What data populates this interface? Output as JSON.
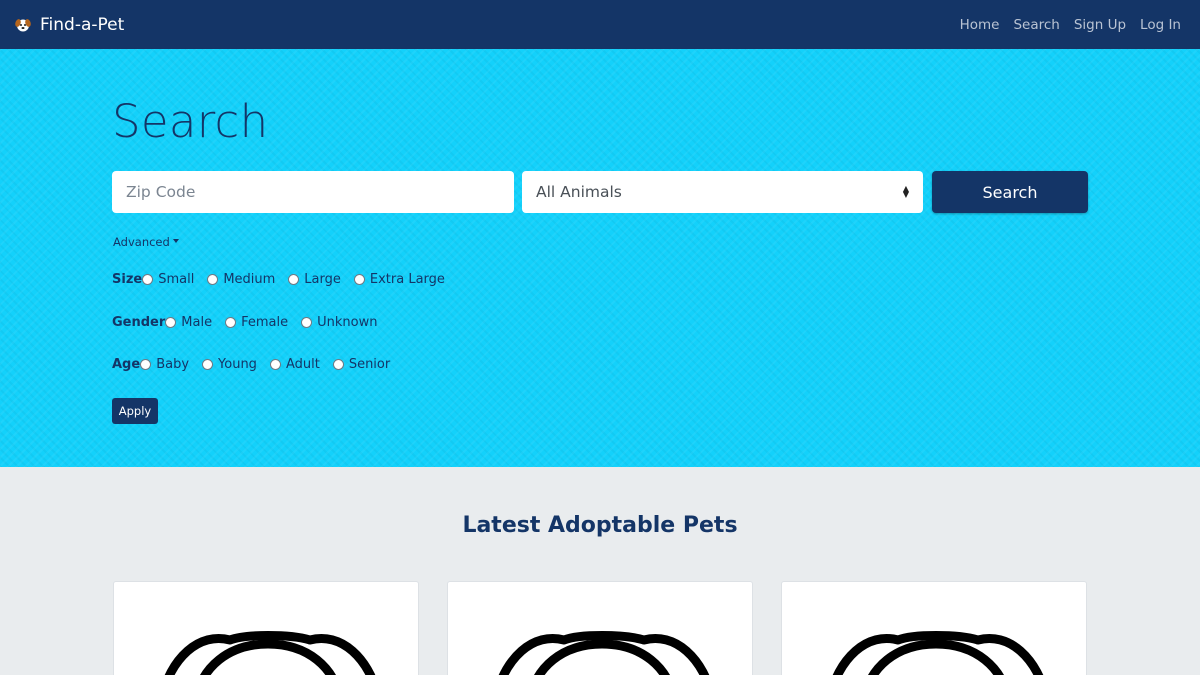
{
  "navbar": {
    "brand": "Find-a-Pet",
    "brand_icon": "dog-face-icon",
    "links": [
      "Home",
      "Search",
      "Sign Up",
      "Log In"
    ]
  },
  "hero": {
    "title": "Search",
    "zip_placeholder": "Zip Code",
    "animal_select_value": "All Animals",
    "search_button": "Search",
    "advanced_label": "Advanced",
    "filters": {
      "size": {
        "label": "Size",
        "options": [
          "Small",
          "Medium",
          "Large",
          "Extra Large"
        ]
      },
      "gender": {
        "label": "Gender",
        "options": [
          "Male",
          "Female",
          "Unknown"
        ]
      },
      "age": {
        "label": "Age",
        "options": [
          "Baby",
          "Young",
          "Adult",
          "Senior"
        ]
      }
    },
    "apply_button": "Apply"
  },
  "latest": {
    "title": "Latest Adoptable Pets",
    "card_icon": "dog-placeholder-icon"
  },
  "colors": {
    "navbar_bg": "#143567",
    "hero_bg": "#13d1fb",
    "accent": "#143567",
    "page_bg": "#e9ecee"
  }
}
